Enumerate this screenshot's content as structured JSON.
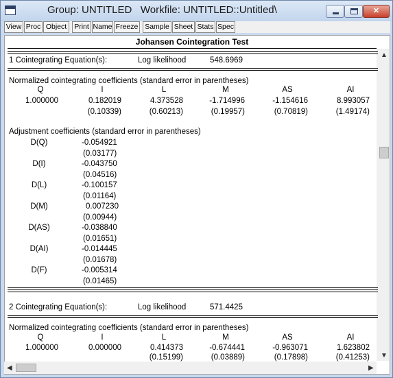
{
  "window": {
    "title": "Group: UNTITLED   Workfile: UNTITLED::Untitled\\"
  },
  "toolbar": {
    "buttons": [
      "View",
      "Proc",
      "Object",
      "Print",
      "Name",
      "Freeze",
      "Sample",
      "Sheet",
      "Stats",
      "Spec"
    ]
  },
  "report": {
    "header": "Johansen Cointegration Test",
    "section1": {
      "equations_label": "1 Cointegrating Equation(s):",
      "loglik_label": "Log likelihood",
      "loglik_value": "548.6969",
      "norm_title": "Normalized cointegrating coefficients (standard error in parentheses)",
      "columns": [
        "Q",
        "I",
        "L",
        "M",
        "AS",
        "AI"
      ],
      "coefficients": [
        "1.000000",
        "0.182019",
        "4.373528",
        "-1.714996",
        "-1.154616",
        "8.993057"
      ],
      "std_errors": [
        "",
        "(0.10339)",
        "(0.60213)",
        "(0.19957)",
        "(0.70819)",
        "(1.49174)"
      ],
      "adj_title": "Adjustment coefficients (standard error in parentheses)",
      "adjustments": [
        {
          "name": "D(Q)",
          "value": "-0.054921",
          "se": "(0.03177)"
        },
        {
          "name": "D(I)",
          "value": "-0.043750",
          "se": "(0.04516)"
        },
        {
          "name": "D(L)",
          "value": "-0.100157",
          "se": "(0.01164)"
        },
        {
          "name": "D(M)",
          "value": "0.007230",
          "se": "(0.00944)"
        },
        {
          "name": "D(AS)",
          "value": "-0.038840",
          "se": "(0.01651)"
        },
        {
          "name": "D(AI)",
          "value": "-0.014445",
          "se": "(0.01678)"
        },
        {
          "name": "D(F)",
          "value": "-0.005314",
          "se": "(0.01465)"
        }
      ]
    },
    "section2": {
      "equations_label": "2 Cointegrating Equation(s):",
      "loglik_label": "Log likelihood",
      "loglik_value": "571.4425",
      "norm_title": "Normalized cointegrating coefficients (standard error in parentheses)",
      "columns": [
        "Q",
        "I",
        "L",
        "M",
        "AS",
        "AI"
      ],
      "coefficients": [
        "1.000000",
        "0.000000",
        "0.414373",
        "-0.674441",
        "-0.963071",
        "1.623802"
      ],
      "std_errors": [
        "",
        "",
        "(0.15199)",
        "(0.03889)",
        "(0.17898)",
        "(0.41253)"
      ]
    }
  },
  "scrollbars": {
    "up_icon": "scroll-up-arrow",
    "down_icon": "scroll-down-arrow",
    "left_icon": "scroll-left-arrow",
    "right_icon": "scroll-right-arrow"
  }
}
